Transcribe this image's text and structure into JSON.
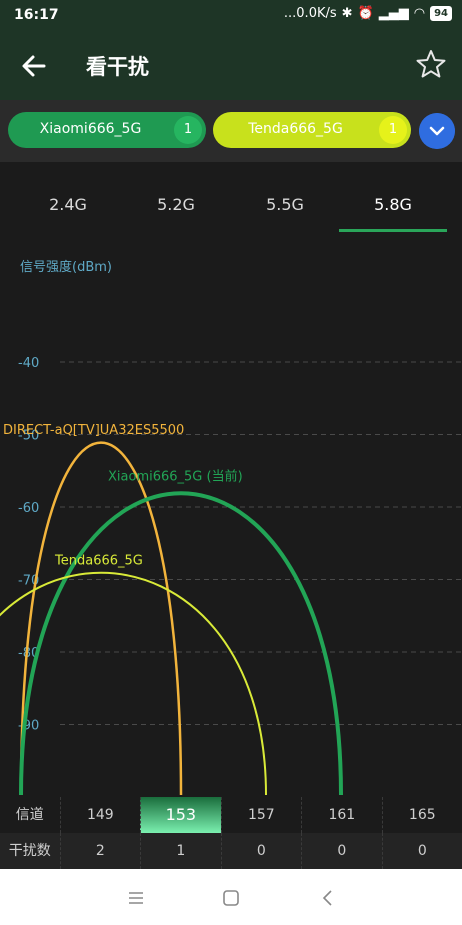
{
  "status": {
    "time": "16:17",
    "net": "...0.0K/s",
    "battery": "94"
  },
  "appbar": {
    "title": "看干扰"
  },
  "chips": [
    {
      "label": "Xiaomi666_5G",
      "count": "1"
    },
    {
      "label": "Tenda666_5G",
      "count": "1"
    }
  ],
  "tabs": [
    {
      "label": "2.4G"
    },
    {
      "label": "5.2G"
    },
    {
      "label": "5.5G"
    },
    {
      "label": "5.8G"
    }
  ],
  "chart": {
    "ylabel": "信号强度(dBm)",
    "ticks": [
      "-40",
      "-50",
      "-60",
      "-70",
      "-80",
      "-90"
    ],
    "networks": [
      {
        "label": "DIRECT-aQ[TV]UA32ES5500",
        "peak_dbm": -51,
        "channel": 149,
        "color": "#f2b43c"
      },
      {
        "label": "Xiaomi666_5G (当前)",
        "peak_dbm": -58,
        "channel": 153,
        "color": "#22a556"
      },
      {
        "label": "Tenda666_5G",
        "peak_dbm": -69,
        "channel": 149,
        "color": "#d9ea38"
      }
    ]
  },
  "table": {
    "channel_label": "信道",
    "interference_label": "干扰数",
    "channels": [
      "149",
      "153",
      "157",
      "161",
      "165"
    ],
    "counts": [
      "2",
      "1",
      "0",
      "0",
      "0"
    ]
  }
}
